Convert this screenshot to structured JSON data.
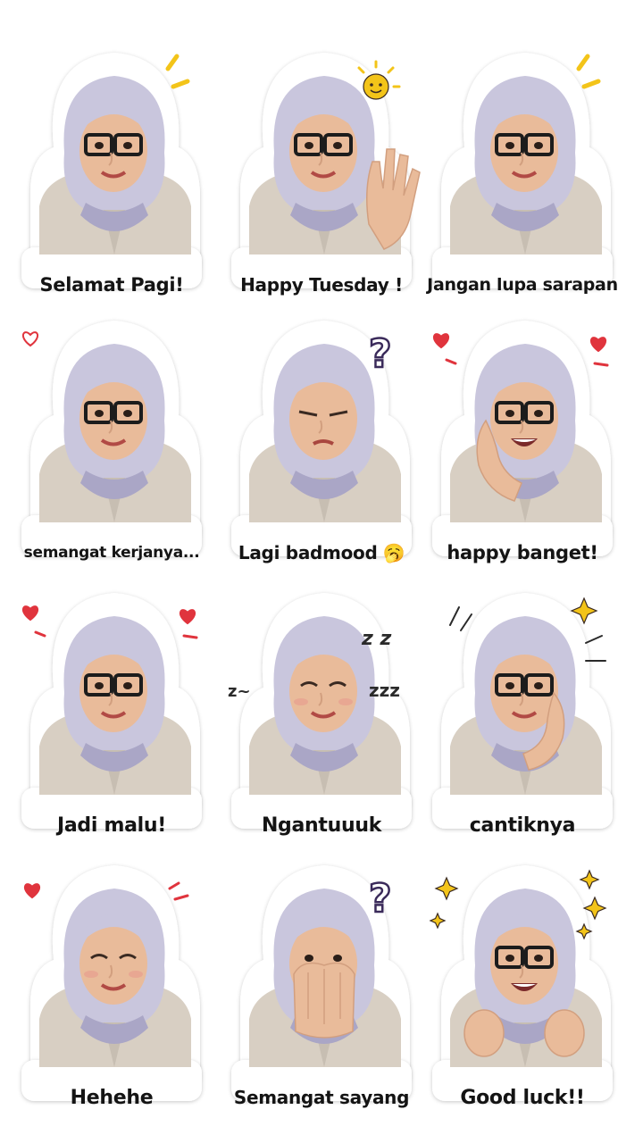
{
  "stickers": [
    {
      "caption": "Selamat Pagi!",
      "font": 21,
      "deco": "sparkle-lines",
      "pose": "neutral"
    },
    {
      "caption": "Happy Tuesday !",
      "font": 20,
      "deco": "sun",
      "pose": "wave"
    },
    {
      "caption": "Jangan lupa sarapan",
      "font": 19,
      "deco": "sparkle-lines",
      "pose": "neutral"
    },
    {
      "caption": "semangat kerjanya...",
      "font": 17,
      "deco": "heart-outline",
      "pose": "neutral"
    },
    {
      "caption": "Lagi badmood",
      "font": 20,
      "deco": "question",
      "pose": "pout",
      "emoji": "🥱"
    },
    {
      "caption": "happy banget!",
      "font": 21,
      "deco": "hearts",
      "pose": "cheek"
    },
    {
      "caption": "Jadi malu!",
      "font": 22,
      "deco": "hearts",
      "pose": "neutral"
    },
    {
      "caption": "Ngantuuuk",
      "font": 22,
      "deco": "zzz",
      "pose": "sleepy"
    },
    {
      "caption": "cantiknya",
      "font": 22,
      "deco": "sparkle-star",
      "pose": "chin"
    },
    {
      "caption": "Hehehe",
      "font": 22,
      "deco": "heart-blush",
      "pose": "wink"
    },
    {
      "caption": "Semangat sayang",
      "font": 20,
      "deco": "question",
      "pose": "cover"
    },
    {
      "caption": "Good luck!!",
      "font": 22,
      "deco": "stars",
      "pose": "fists"
    }
  ],
  "colors": {
    "hijab": "#c9c6dd",
    "hijab_shadow": "#aaa6c6",
    "skin": "#e9bb9a",
    "skin_shadow": "#d29f7f",
    "jacket": "#d8cfc3",
    "jacket_shadow": "#bdb3a6",
    "glasses": "#1c1c1c",
    "heart": "#e0343d",
    "star": "#f3c419",
    "sticker_border": "#ffffff",
    "caption": "#141414"
  }
}
